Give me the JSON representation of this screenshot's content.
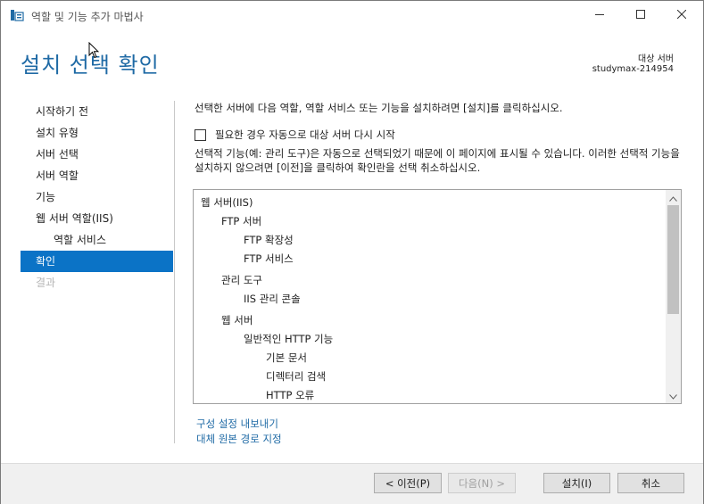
{
  "window": {
    "title": "역할 및 기능 추가 마법사",
    "icon": "server-manager-icon"
  },
  "header": {
    "title": "설치 선택 확인",
    "destination_label": "대상 서버",
    "destination_value": "studymax-214954"
  },
  "nav": {
    "items": [
      {
        "label": "시작하기 전",
        "state": "normal"
      },
      {
        "label": "설치 유형",
        "state": "normal"
      },
      {
        "label": "서버 선택",
        "state": "normal"
      },
      {
        "label": "서버 역할",
        "state": "normal"
      },
      {
        "label": "기능",
        "state": "normal"
      },
      {
        "label": "웹 서버 역할(IIS)",
        "state": "normal"
      },
      {
        "label": "역할 서비스",
        "state": "sub"
      },
      {
        "label": "확인",
        "state": "active"
      },
      {
        "label": "결과",
        "state": "disabled"
      }
    ]
  },
  "content": {
    "intro": "선택한 서버에 다음 역할, 역할 서비스 또는 기능을 설치하려면 [설치]를 클릭하십시오.",
    "restart_label": "필요한 경우 자동으로 대상 서버 다시 시작",
    "restart_checked": false,
    "note": "선택적 기능(예: 관리 도구)은 자동으로 선택되었기 때문에 이 페이지에 표시될 수 있습니다. 이러한 선택적 기능을 설치하지 않으려면 [이전]을 클릭하여 확인란을 선택 취소하십시오.",
    "features": [
      {
        "label": "웹 서버(IIS)",
        "level": 0
      },
      {
        "label": "FTP 서버",
        "level": 1
      },
      {
        "label": "FTP 확장성",
        "level": 2
      },
      {
        "label": "FTP 서비스",
        "level": 2
      },
      {
        "label": "관리 도구",
        "level": 1
      },
      {
        "label": "IIS 관리 콘솔",
        "level": 2
      },
      {
        "label": "웹 서버",
        "level": 1
      },
      {
        "label": "일반적인 HTTP 기능",
        "level": 2
      },
      {
        "label": "기본 문서",
        "level": 3
      },
      {
        "label": "디렉터리 검색",
        "level": 3
      },
      {
        "label": "HTTP 오류",
        "level": 3
      }
    ],
    "link_export": "구성 설정 내보내기",
    "link_source": "대체 원본 경로 지정"
  },
  "footer": {
    "prev_label": "< 이전(P)",
    "next_label": "다음(N) >",
    "install_label": "설치(I)",
    "cancel_label": "취소"
  },
  "colors": {
    "title_blue": "#1f6aa5",
    "nav_active": "#0b73c6",
    "link": "#1f6aa5",
    "footer_bg": "#f0f0f0"
  }
}
